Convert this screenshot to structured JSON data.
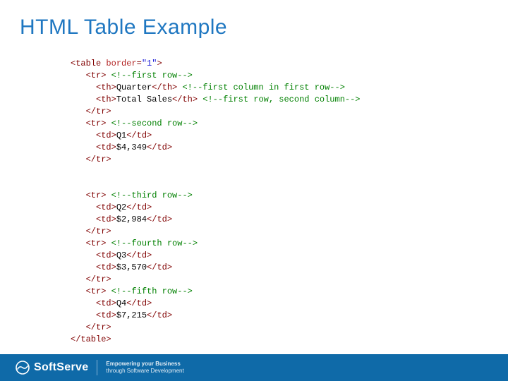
{
  "title": "HTML Table Example",
  "code": {
    "l1_open": "<table ",
    "l1_attr": "border",
    "l1_eq": "=",
    "l1_val": "\"1\"",
    "l1_close": ">",
    "tr_open": "<tr>",
    "tr_close": "</tr>",
    "th_open": "<th>",
    "th_close": "</th>",
    "td_open": "<td>",
    "td_close": "</td>",
    "table_close": "</table>",
    "c_row1": "<!--first row-->",
    "c_col1": "<!--first column in first row-->",
    "c_col2": "<!--first row, second column-->",
    "c_row2": "<!--second row-->",
    "c_row3": "<!--third row-->",
    "c_row4": "<!--fourth row-->",
    "c_row5": "<!--fifth row-->",
    "h1": "Quarter",
    "h2": "Total Sales",
    "q1": "Q1",
    "v1": "$4,349",
    "q2": "Q2",
    "v2": "$2,984",
    "q3": "Q3",
    "v3": "$3,570",
    "q4": "Q4",
    "v4": "$7,215"
  },
  "footer": {
    "brand": "SoftServe",
    "tagline1": "Empowering your Business",
    "tagline2": "through Software Development"
  }
}
